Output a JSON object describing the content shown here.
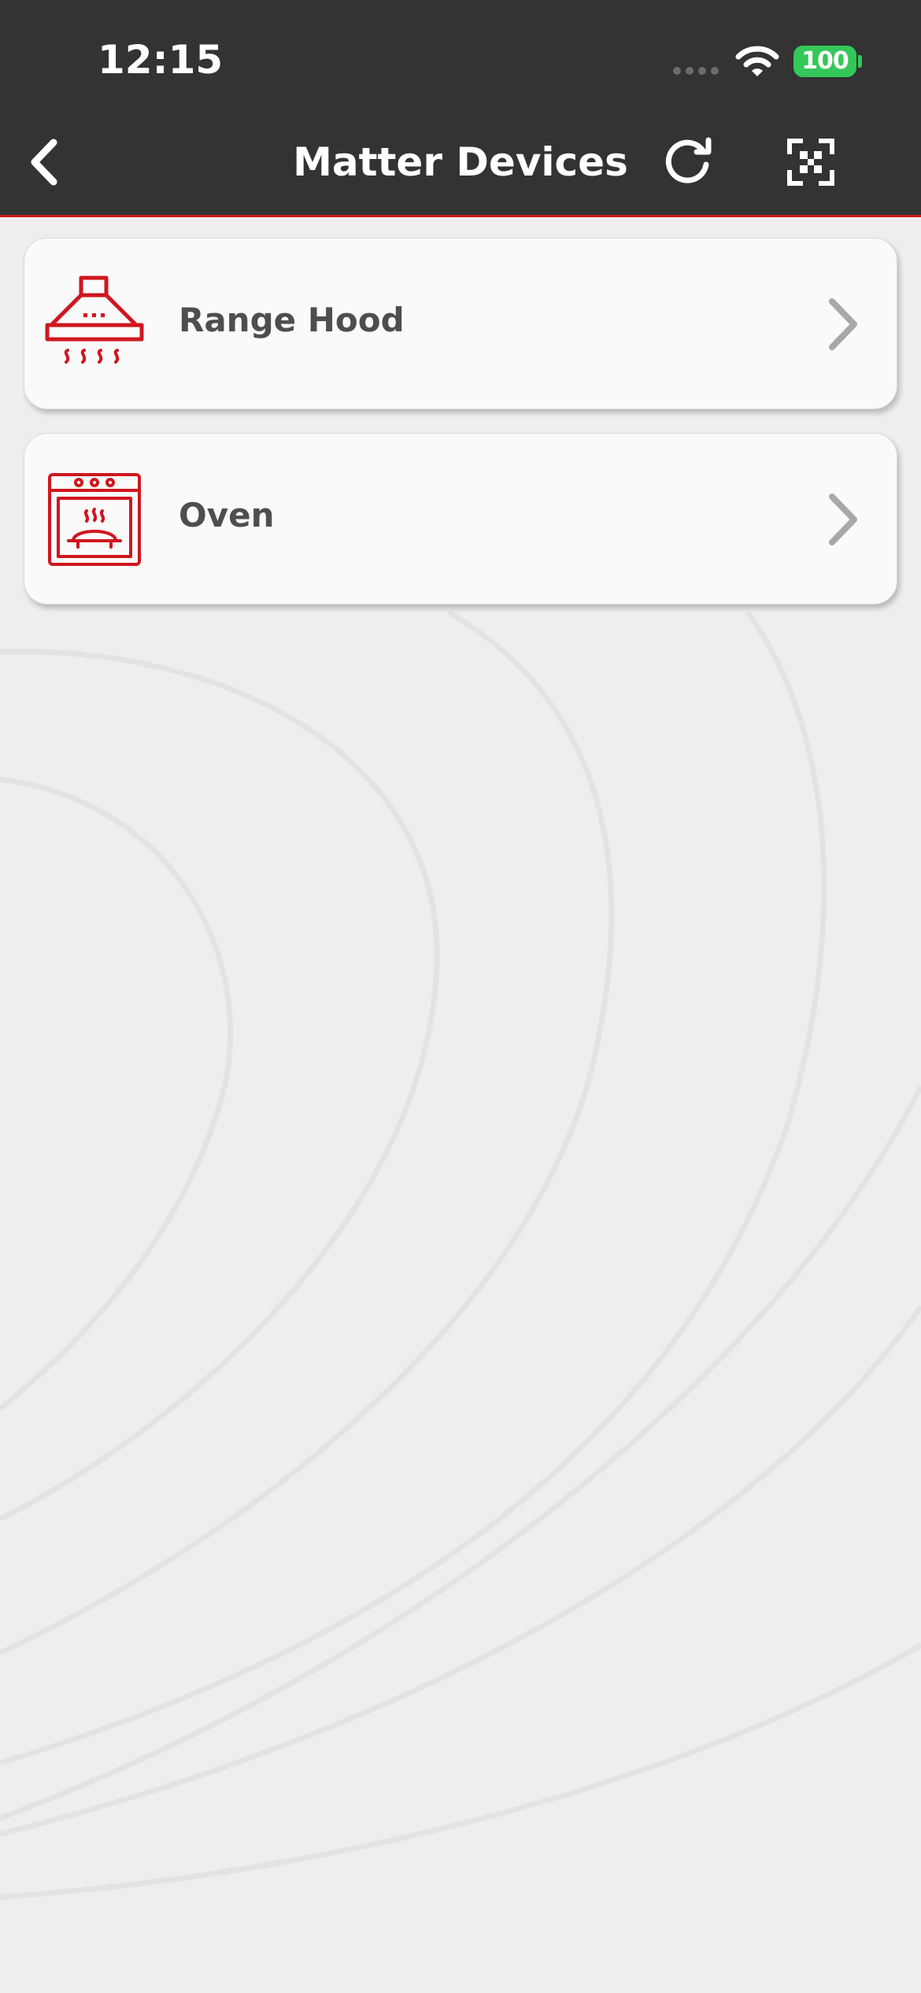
{
  "status_bar": {
    "time": "12:15",
    "battery_level": "100",
    "icons": [
      "cellular-dots-icon",
      "wifi-icon",
      "battery-icon"
    ]
  },
  "nav": {
    "title": "Matter Devices",
    "icons": [
      "back-chevron-icon",
      "refresh-icon",
      "qr-scan-icon"
    ]
  },
  "devices": [
    {
      "label": "Range Hood",
      "icon": "range-hood-icon"
    },
    {
      "label": "Oven",
      "icon": "oven-icon"
    }
  ],
  "colors": {
    "header_bg": "#333333",
    "accent_red": "#d0161f",
    "page_bg": "#eeeeee",
    "card_bg": "#fafafa",
    "label_text": "#4e4e4e",
    "chevron": "#a8a8a8",
    "battery_green": "#34c759"
  }
}
